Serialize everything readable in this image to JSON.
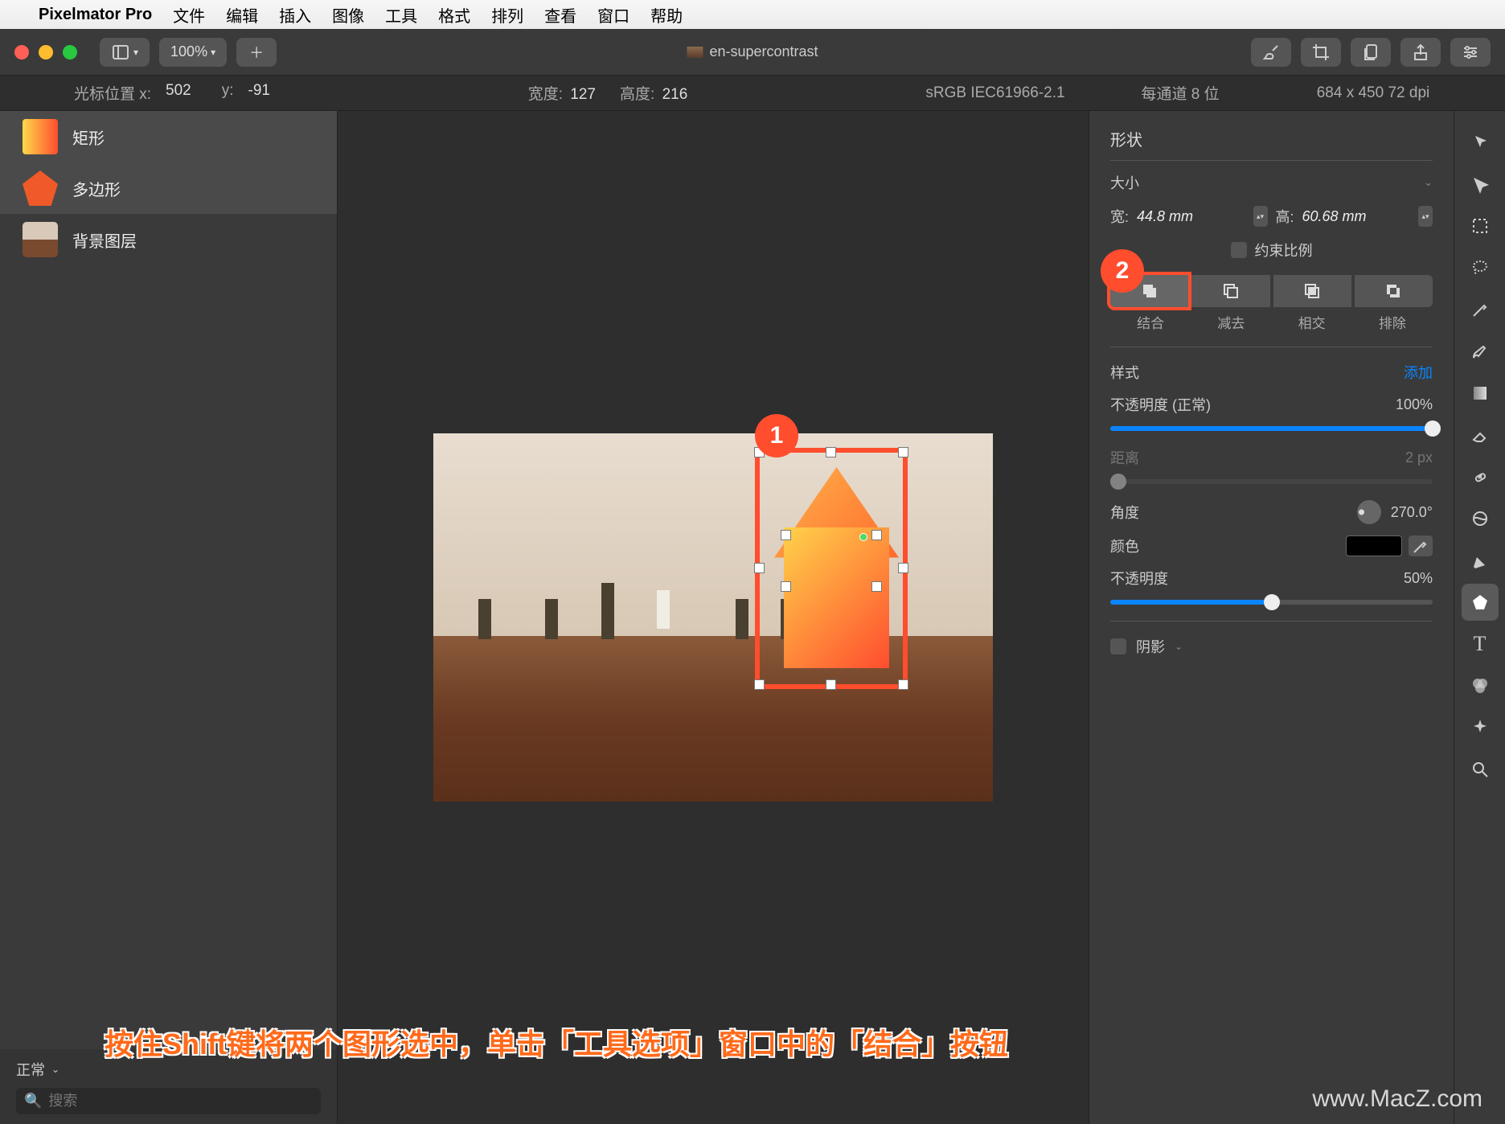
{
  "menubar": {
    "app": "Pixelmator Pro",
    "items": [
      "文件",
      "编辑",
      "插入",
      "图像",
      "工具",
      "格式",
      "排列",
      "查看",
      "窗口",
      "帮助"
    ]
  },
  "toolbar": {
    "zoom": "100%",
    "doc_title": "en-supercontrast"
  },
  "infobar": {
    "cursor_label": "光标位置 x:",
    "cursor_x": "502",
    "cursor_y_label": "y:",
    "cursor_y": "-91",
    "width_label": "宽度:",
    "width_val": "127",
    "height_label": "高度:",
    "height_val": "216",
    "colorspace": "sRGB IEC61966-2.1",
    "depth": "每通道 8 位",
    "dims": "684 x 450 72 dpi"
  },
  "layers": {
    "items": [
      {
        "label": "矩形",
        "thumb": "rect"
      },
      {
        "label": "多边形",
        "thumb": "poly"
      },
      {
        "label": "背景图层",
        "thumb": "bg"
      }
    ],
    "blend_mode": "正常",
    "search_placeholder": "搜索"
  },
  "inspector": {
    "section_shape": "形状",
    "size_header": "大小",
    "width_label": "宽:",
    "width_val": "44.8 mm",
    "height_label": "高:",
    "height_val": "60.68 mm",
    "constrain_label": "约束比例",
    "bool_ops": [
      "结合",
      "减去",
      "相交",
      "排除"
    ],
    "style_label": "样式",
    "style_add": "添加",
    "opacity_label": "不透明度 (正常)",
    "opacity_val": "100%",
    "spacing_label": "距离",
    "spacing_val": "2 px",
    "angle_label": "角度",
    "angle_val": "270.0°",
    "color_label": "颜色",
    "opacity2_label": "不透明度",
    "opacity2_val": "50%",
    "shadow_label": "阴影"
  },
  "callouts": {
    "one": "1",
    "two": "2"
  },
  "caption": "按住Shift键将两个图形选中，单击「工具选项」窗口中的「结合」按钮",
  "watermark": "www.MacZ.com"
}
